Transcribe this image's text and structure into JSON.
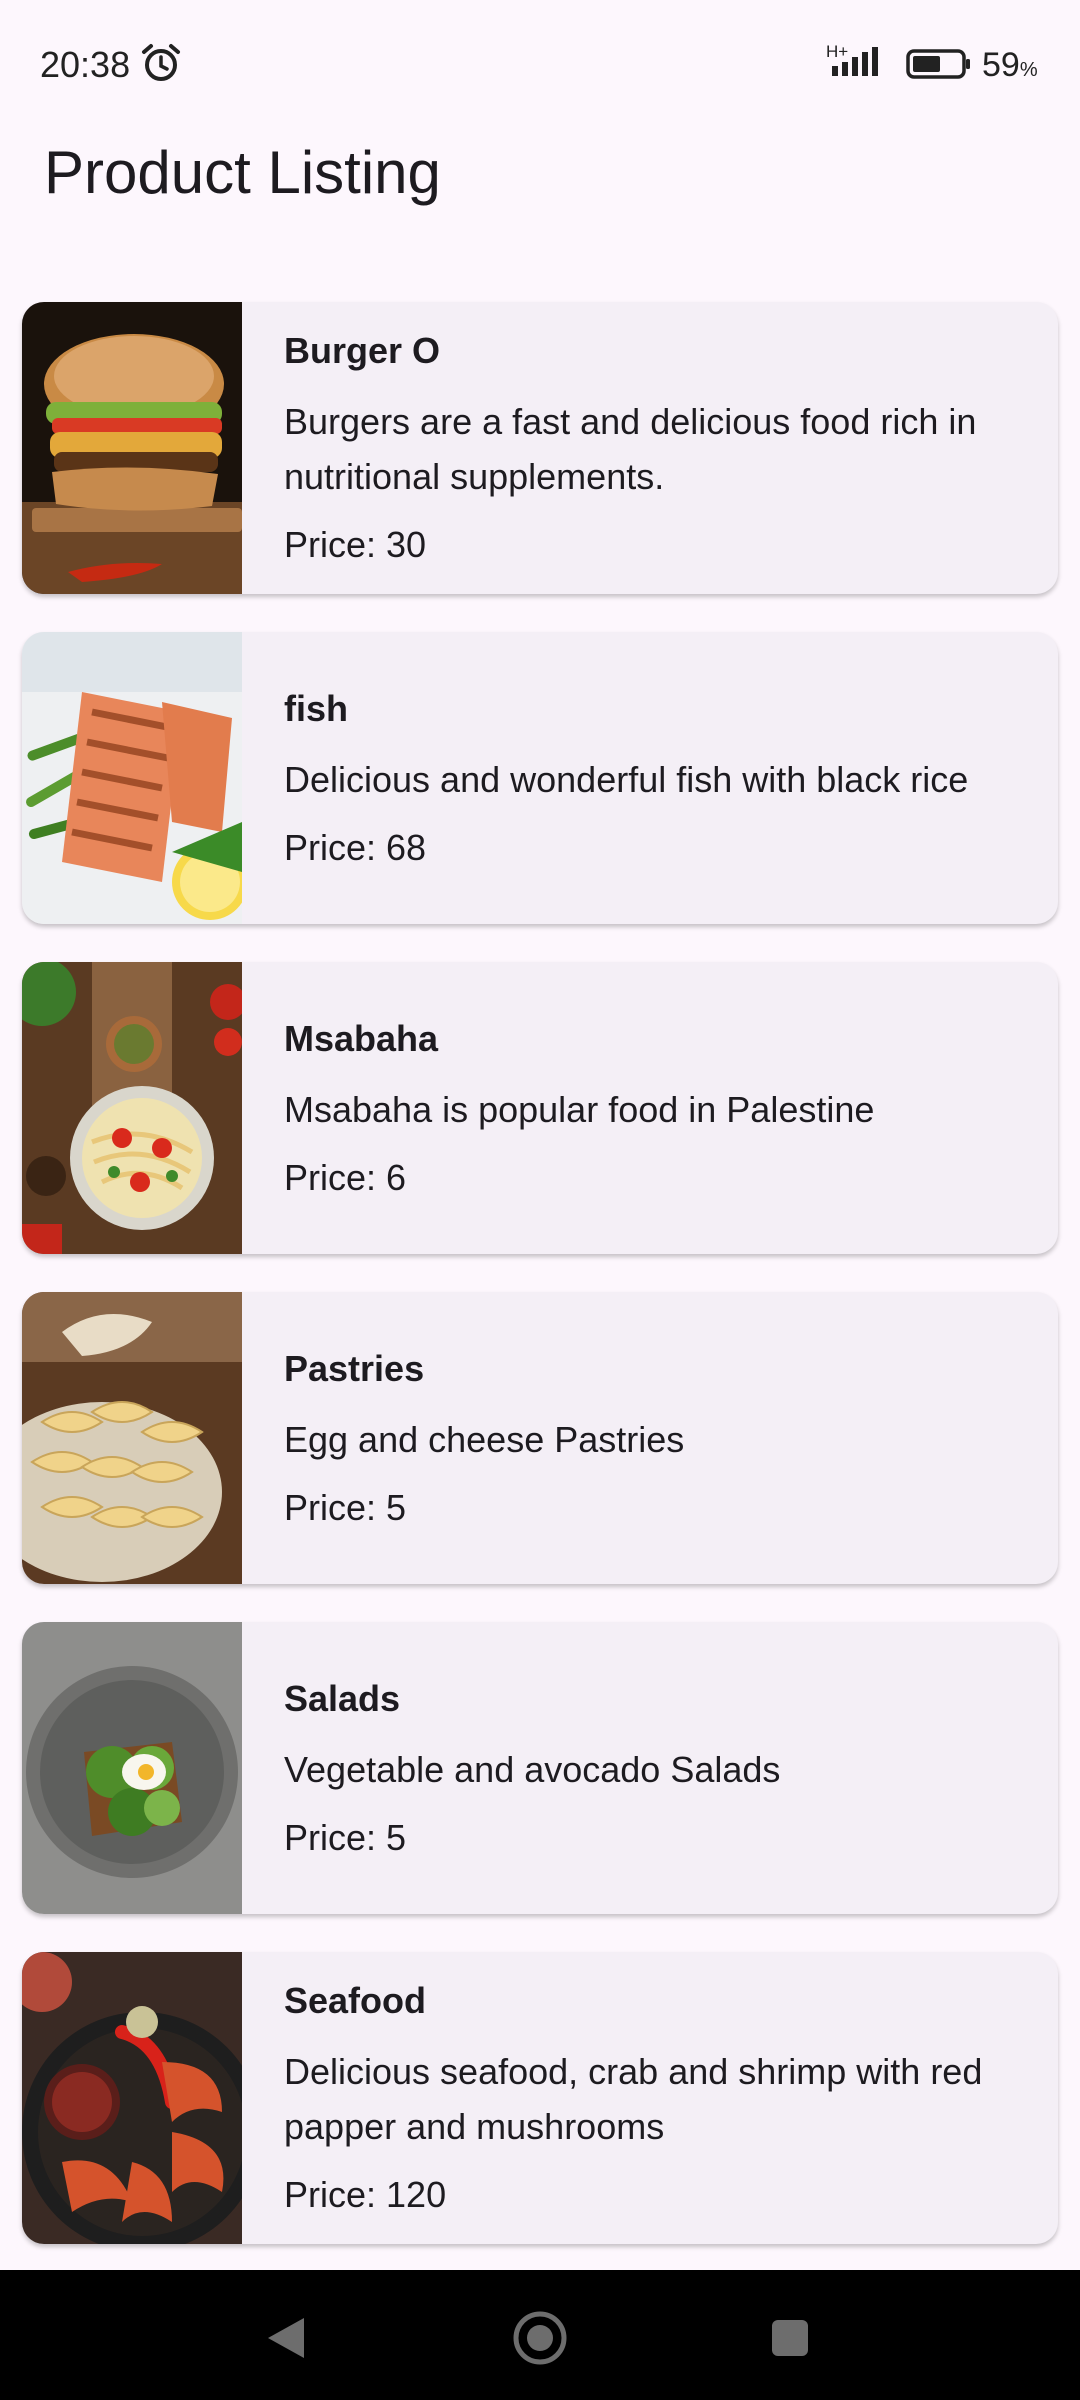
{
  "status_bar": {
    "time": "20:38",
    "network": "H+",
    "battery_percent": "59",
    "battery_unit": "%",
    "battery_level": 0.59,
    "icons": [
      "alarm-icon",
      "signal-icon",
      "battery-icon"
    ]
  },
  "page": {
    "title": "Product Listing"
  },
  "products": [
    {
      "name": "Burger O",
      "description": "Burgers are a fast and delicious food rich in nutritional supplements.",
      "price_label": "Price: 30",
      "image": "burger-image"
    },
    {
      "name": "fish",
      "description": "Delicious and wonderful fish with black rice",
      "price_label": "Price: 68",
      "image": "fish-image"
    },
    {
      "name": "Msabaha",
      "description": "Msabaha is popular food in Palestine",
      "price_label": "Price: 6",
      "image": "msabaha-image"
    },
    {
      "name": "Pastries",
      "description": "Egg and cheese Pastries",
      "price_label": "Price: 5",
      "image": "pastries-image"
    },
    {
      "name": "Salads",
      "description": "Vegetable and avocado Salads",
      "price_label": "Price: 5",
      "image": "salads-image"
    },
    {
      "name": "Seafood",
      "description": "Delicious seafood, crab and shrimp with red papper and mushrooms",
      "price_label": "Price: 120",
      "image": "seafood-image"
    }
  ],
  "nav_bar": {
    "icons": [
      "back-icon",
      "home-icon",
      "recents-icon"
    ]
  },
  "colors": {
    "background": "#fdf7fd",
    "card": "#f4eff6",
    "text": "#1d1b20",
    "nav_bar": "#000000"
  }
}
